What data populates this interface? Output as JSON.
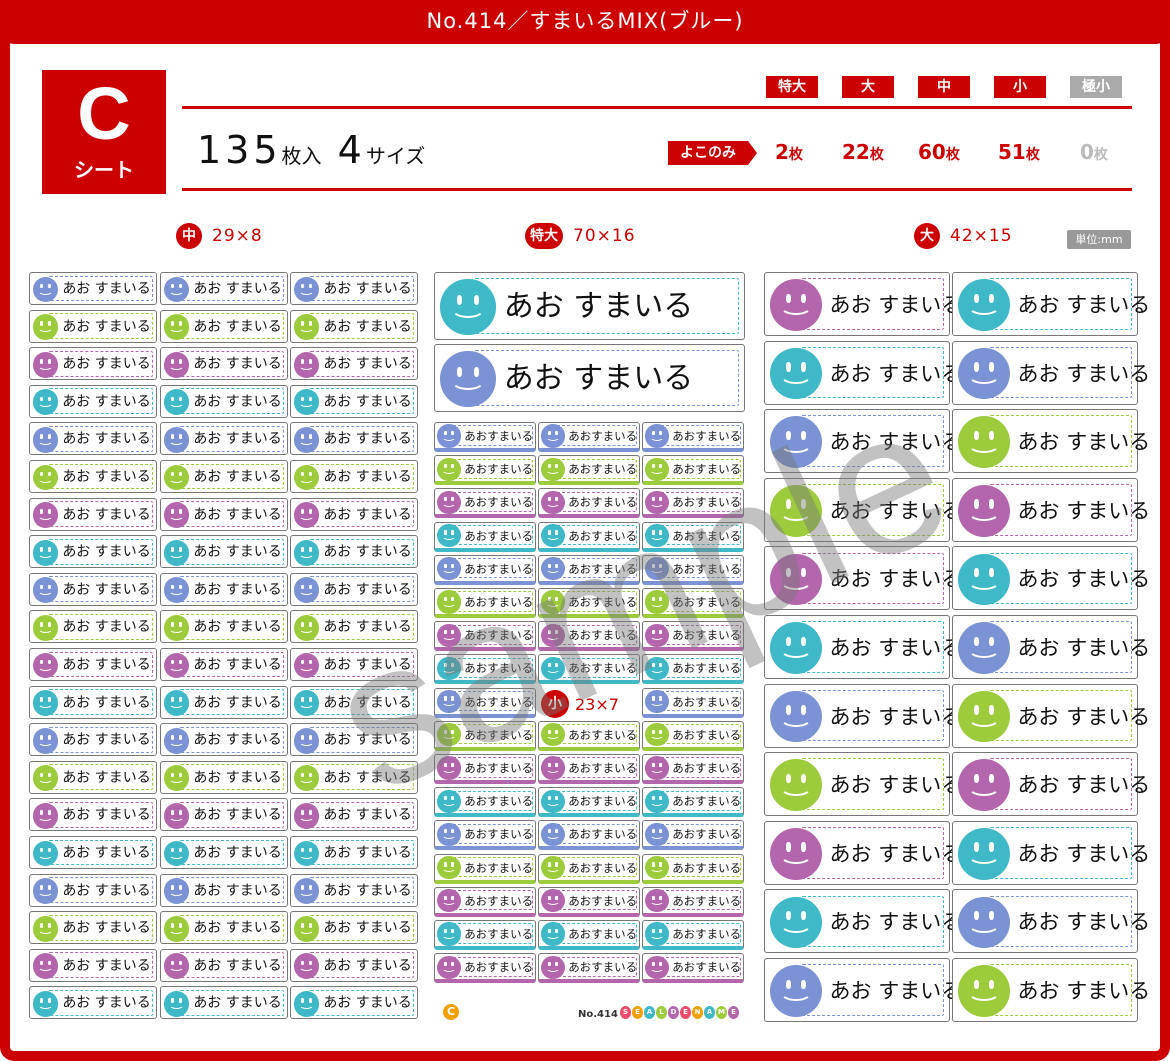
{
  "title": "No.414／すまいるMIX(ブルー)",
  "sheet": {
    "letter": "C",
    "label": "シート"
  },
  "count": {
    "main": "135",
    "unit1": "枚入",
    "sizes": "4",
    "unit2": "サイズ"
  },
  "size_badges": [
    {
      "label": "特大",
      "count": "2",
      "gray": false
    },
    {
      "label": "大",
      "count": "22",
      "gray": false
    },
    {
      "label": "中",
      "count": "60",
      "gray": false
    },
    {
      "label": "小",
      "count": "51",
      "gray": false
    },
    {
      "label": "極小",
      "count": "0",
      "gray": true
    }
  ],
  "count_unit": "枚",
  "yoko_label": "よこのみ",
  "sections": [
    {
      "badge": "中",
      "dims": "29×8"
    },
    {
      "badge": "特大",
      "dims": "70×16"
    },
    {
      "badge": "大",
      "dims": "42×15"
    }
  ],
  "small_section": {
    "badge": "小",
    "dims": "23×7"
  },
  "unit_label": "単位:mm",
  "label_text": "あお すまいる",
  "label_text_compact": "あおすまいる",
  "watermark": "sample",
  "footer": {
    "logo": "C",
    "number": "No.414",
    "brand": "SEALDENAME"
  },
  "colors": {
    "red": "#cc0000",
    "blue": "#7b93d4",
    "green": "#9ccc3c",
    "purple": "#b466ac",
    "teal": "#3fb8c8"
  },
  "label_patterns": {
    "medium": [
      "blue",
      "green",
      "purple",
      "teal",
      "blue",
      "green",
      "purple",
      "teal",
      "blue",
      "green",
      "purple",
      "teal",
      "blue",
      "green",
      "purple",
      "teal",
      "blue",
      "green",
      "purple",
      "teal"
    ],
    "xl": [
      "teal",
      "blue"
    ],
    "small": [
      "blue",
      "green",
      "purple",
      "teal",
      "blue",
      "green",
      "purple",
      "teal",
      "blue",
      "green",
      "purple",
      "teal",
      "blue",
      "green",
      "purple",
      "teal",
      "purple"
    ],
    "large_left": [
      "purple",
      "teal",
      "blue",
      "green",
      "purple",
      "teal",
      "blue",
      "green",
      "purple",
      "teal",
      "blue"
    ],
    "large_right": [
      "teal",
      "blue",
      "green",
      "purple",
      "teal",
      "blue",
      "green",
      "purple",
      "teal",
      "blue",
      "green"
    ]
  }
}
